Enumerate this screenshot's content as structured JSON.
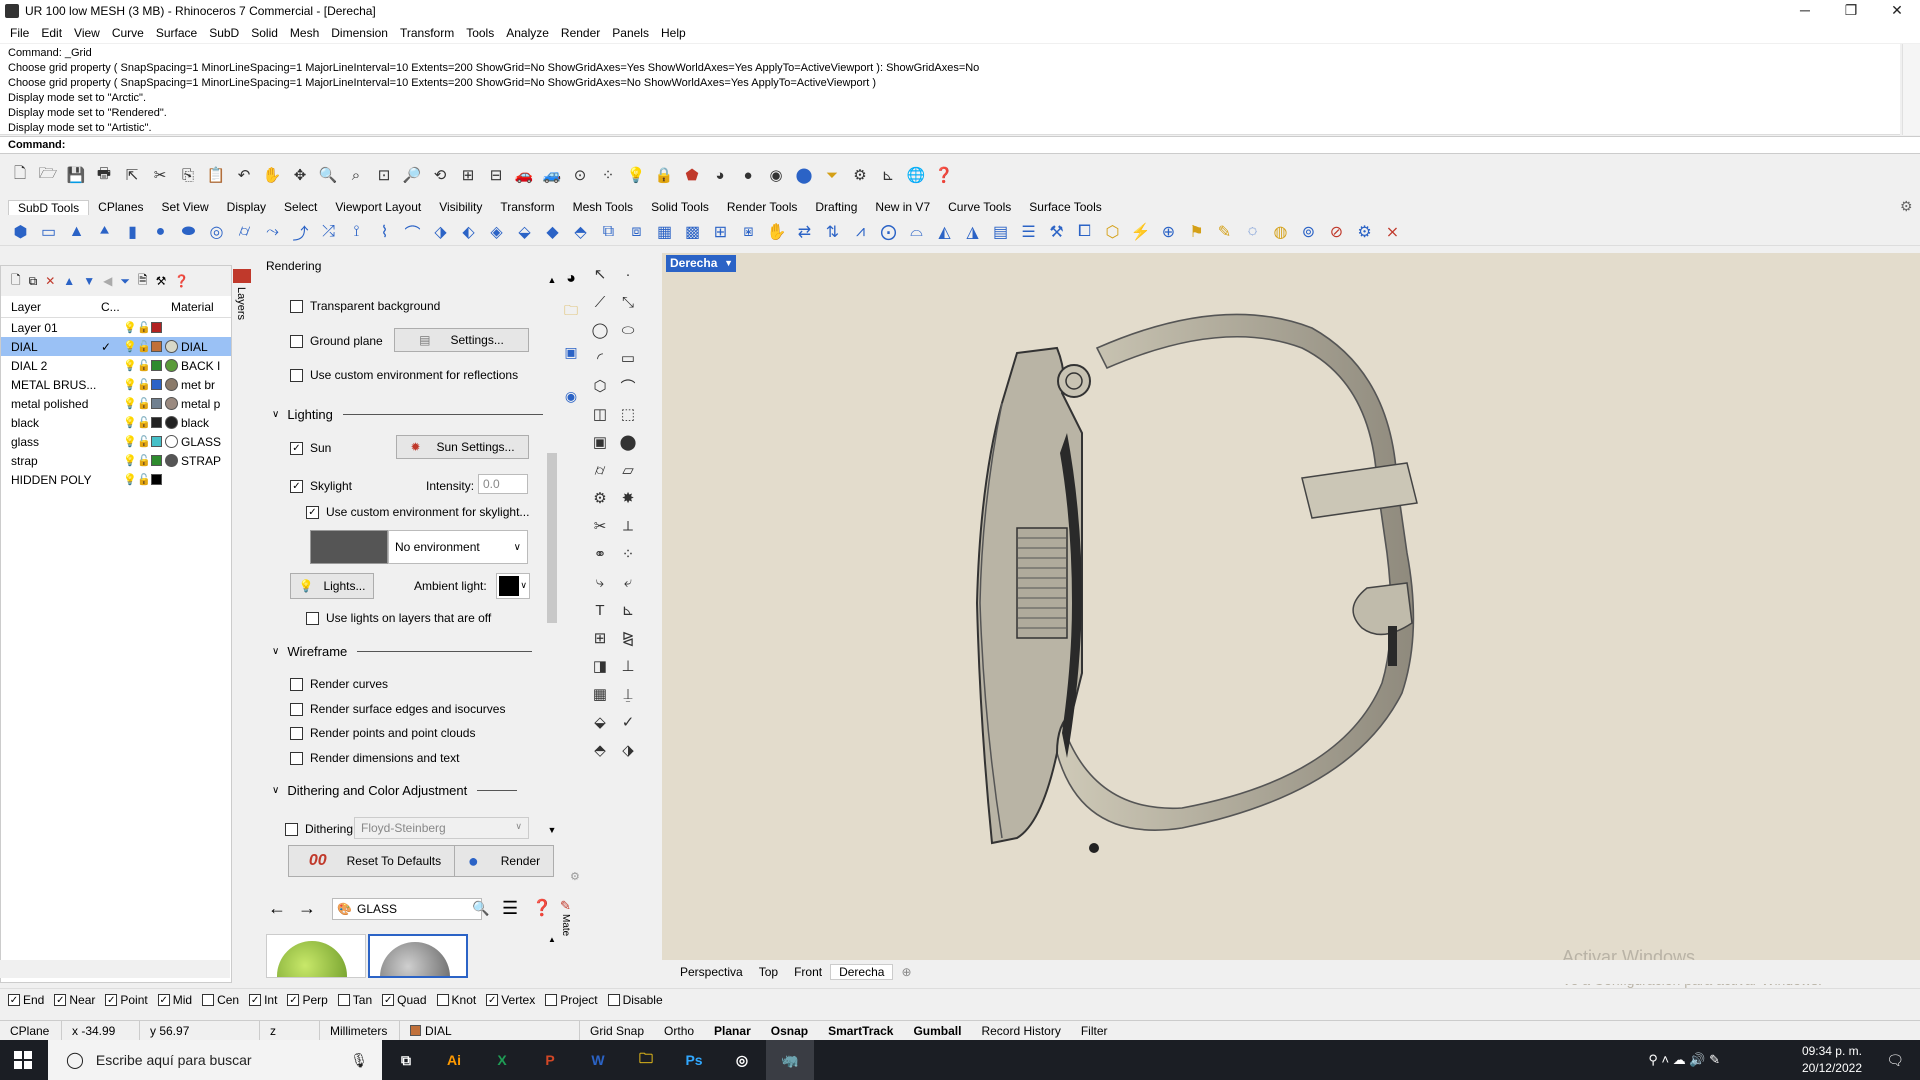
{
  "window": {
    "title": "UR 100 low MESH (3 MB) - Rhinoceros 7 Commercial - [Derecha]",
    "minimize": "─",
    "maximize": "❐",
    "close": "✕"
  },
  "menu": [
    "File",
    "Edit",
    "View",
    "Curve",
    "Surface",
    "SubD",
    "Solid",
    "Mesh",
    "Dimension",
    "Transform",
    "Tools",
    "Analyze",
    "Render",
    "Panels",
    "Help"
  ],
  "command_history": [
    "Command: _Grid",
    "Choose grid property ( SnapSpacing=1  MinorLineSpacing=1  MajorLineInterval=10  Extents=200  ShowGrid=No  ShowGridAxes=Yes  ShowWorldAxes=Yes  ApplyTo=ActiveViewport ): ShowGridAxes=No",
    "Choose grid property ( SnapSpacing=1  MinorLineSpacing=1  MajorLineInterval=10  Extents=200  ShowGrid=No  ShowGridAxes=No  ShowWorldAxes=Yes  ApplyTo=ActiveViewport )",
    "Display mode set to \"Arctic\".",
    "Display mode set to \"Rendered\".",
    "Display mode set to \"Artistic\"."
  ],
  "command_prompt": "Command:",
  "toolbar_tabs": [
    "SubD Tools",
    "CPlanes",
    "Set View",
    "Display",
    "Select",
    "Viewport Layout",
    "Visibility",
    "Transform",
    "Mesh Tools",
    "Solid Tools",
    "Render Tools",
    "Drafting",
    "New in V7",
    "Curve Tools",
    "Surface Tools"
  ],
  "layers": {
    "header": {
      "layer": "Layer",
      "current": "C...",
      "material": "Material"
    },
    "rows": [
      {
        "name": "Layer 01",
        "color": "#b22222",
        "material": "",
        "material_color": "",
        "selected": false,
        "current": false,
        "bulb": "blue"
      },
      {
        "name": "DIAL",
        "color": "#c0703a",
        "material": "DIAL",
        "material_color": "#d8d8c8",
        "selected": true,
        "current": true,
        "bulb": "yellow"
      },
      {
        "name": "DIAL 2",
        "color": "#2e8b2e",
        "material": "BACK I",
        "material_color": "#5a9b3a",
        "selected": false,
        "current": false,
        "bulb": "yellow"
      },
      {
        "name": "METAL BRUS...",
        "color": "#2b63c6",
        "material": "met br",
        "material_color": "#8a7a6a",
        "selected": false,
        "current": false,
        "bulb": "yellow"
      },
      {
        "name": "metal polished",
        "color": "#708090",
        "material": "metal p",
        "material_color": "#9a8a80",
        "selected": false,
        "current": false,
        "bulb": "yellow"
      },
      {
        "name": "black",
        "color": "#222222",
        "material": "black",
        "material_color": "#222222",
        "selected": false,
        "current": false,
        "bulb": "yellow"
      },
      {
        "name": "glass",
        "color": "#46c0c8",
        "material": "GLASS",
        "material_color": "#ffffff",
        "selected": false,
        "current": false,
        "bulb": "yellow"
      },
      {
        "name": "strap",
        "color": "#2e8b2e",
        "material": "STRAP",
        "material_color": "#555555",
        "selected": false,
        "current": false,
        "bulb": "yellow"
      },
      {
        "name": "HIDDEN POLY",
        "color": "#000000",
        "material": "",
        "material_color": "",
        "selected": false,
        "current": false,
        "bulb": "blue"
      }
    ],
    "side_tab": "Layers"
  },
  "rendering": {
    "title": "Rendering",
    "transparent_background": "Transparent background",
    "ground_plane": "Ground plane",
    "settings_button": "Settings...",
    "custom_env_reflections": "Use custom environment for reflections",
    "lighting_section": "Lighting",
    "sun": "Sun",
    "sun_settings": "Sun Settings...",
    "skylight": "Skylight",
    "intensity_label": "Intensity:",
    "intensity_value": "0.0",
    "custom_env_skylight": "Use custom environment for skylight...",
    "environment_select": "No environment",
    "lights_button": "Lights...",
    "ambient_label": "Ambient light:",
    "lights_off_layers": "Use lights on layers that are off",
    "wireframe_section": "Wireframe",
    "render_curves": "Render curves",
    "render_edges": "Render surface edges and isocurves",
    "render_points": "Render points and point clouds",
    "render_dims": "Render dimensions and text",
    "dithering_section": "Dithering and Color Adjustment",
    "dithering_label": "Dithering:",
    "dithering_value": "Floyd-Steinberg",
    "reset_button": "Reset To Defaults",
    "render_button": "Render"
  },
  "materials": {
    "search_value": "GLASS",
    "side_tab": "Mate"
  },
  "viewport": {
    "label": "Derecha",
    "tabs": [
      "Perspectiva",
      "Top",
      "Front",
      "Derecha"
    ],
    "active_tab": "Derecha",
    "watermark_title": "Activar Windows",
    "watermark_sub": "Ve a Configuración para activar Windows."
  },
  "osnap": [
    {
      "label": "End",
      "checked": true
    },
    {
      "label": "Near",
      "checked": true
    },
    {
      "label": "Point",
      "checked": true
    },
    {
      "label": "Mid",
      "checked": true
    },
    {
      "label": "Cen",
      "checked": false
    },
    {
      "label": "Int",
      "checked": true
    },
    {
      "label": "Perp",
      "checked": true
    },
    {
      "label": "Tan",
      "checked": false
    },
    {
      "label": "Quad",
      "checked": true
    },
    {
      "label": "Knot",
      "checked": false
    },
    {
      "label": "Vertex",
      "checked": true
    },
    {
      "label": "Project",
      "checked": false
    },
    {
      "label": "Disable",
      "checked": false
    }
  ],
  "status": {
    "cplane": "CPlane",
    "x": "x -34.99",
    "y": "y 56.97",
    "z": "z",
    "units": "Millimeters",
    "layer": "DIAL",
    "grid_snap": "Grid Snap",
    "ortho": "Ortho",
    "planar": "Planar",
    "osnap": "Osnap",
    "smarttrack": "SmartTrack",
    "gumball": "Gumball",
    "record_history": "Record History",
    "filter": "Filter"
  },
  "taskbar": {
    "search_placeholder": "Escribe aquí para buscar",
    "time": "09:34 p. m.",
    "date": "20/12/2022"
  },
  "colors": {
    "accent": "#2b63c6",
    "selection": "#9ac1f5",
    "viewport_bg": "#e3dccc"
  }
}
